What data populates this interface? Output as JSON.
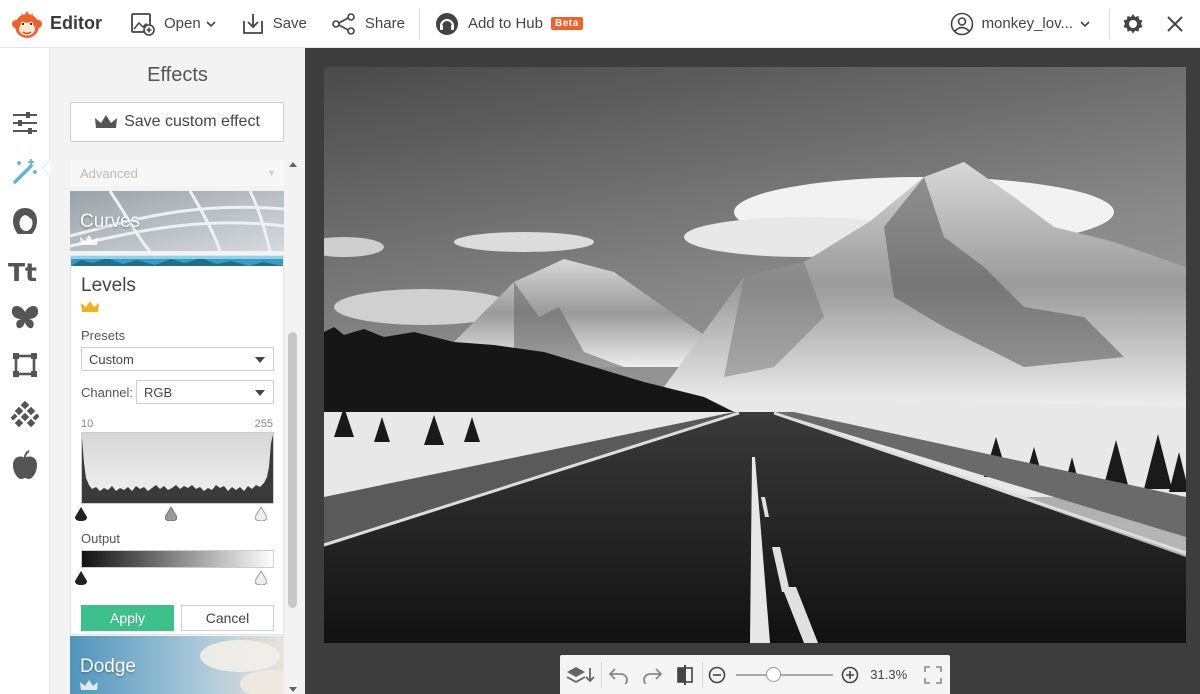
{
  "app": {
    "name": "Editor",
    "accent": "#f0622c"
  },
  "toolbar": {
    "open_label": "Open",
    "save_label": "Save",
    "share_label": "Share",
    "hub_label": "Add to Hub",
    "hub_badge": "Beta",
    "user_name": "monkey_lov..."
  },
  "rail": {
    "items": [
      "sliders-icon",
      "magic-wand-icon",
      "portrait-icon",
      "text-icon",
      "butterfly-icon",
      "frame-icon",
      "texture-icon",
      "apple-icon"
    ],
    "active": "magic-wand-icon"
  },
  "panel": {
    "title": "Effects",
    "save_custom_label": "Save custom effect",
    "category": "Advanced",
    "effects_above": [
      {
        "label": "Curves"
      }
    ],
    "effects_below": [
      {
        "label": "Dodge"
      }
    ],
    "levels": {
      "title": "Levels",
      "presets_label": "Presets",
      "preset_value": "Custom",
      "channel_label": "Channel:",
      "channel_value": "RGB",
      "input_low": "10",
      "input_high": "255",
      "output_label": "Output",
      "apply_label": "Apply",
      "cancel_label": "Cancel",
      "apply_color": "#3ec08a"
    }
  },
  "canvas": {
    "zoom": "31.3%"
  }
}
